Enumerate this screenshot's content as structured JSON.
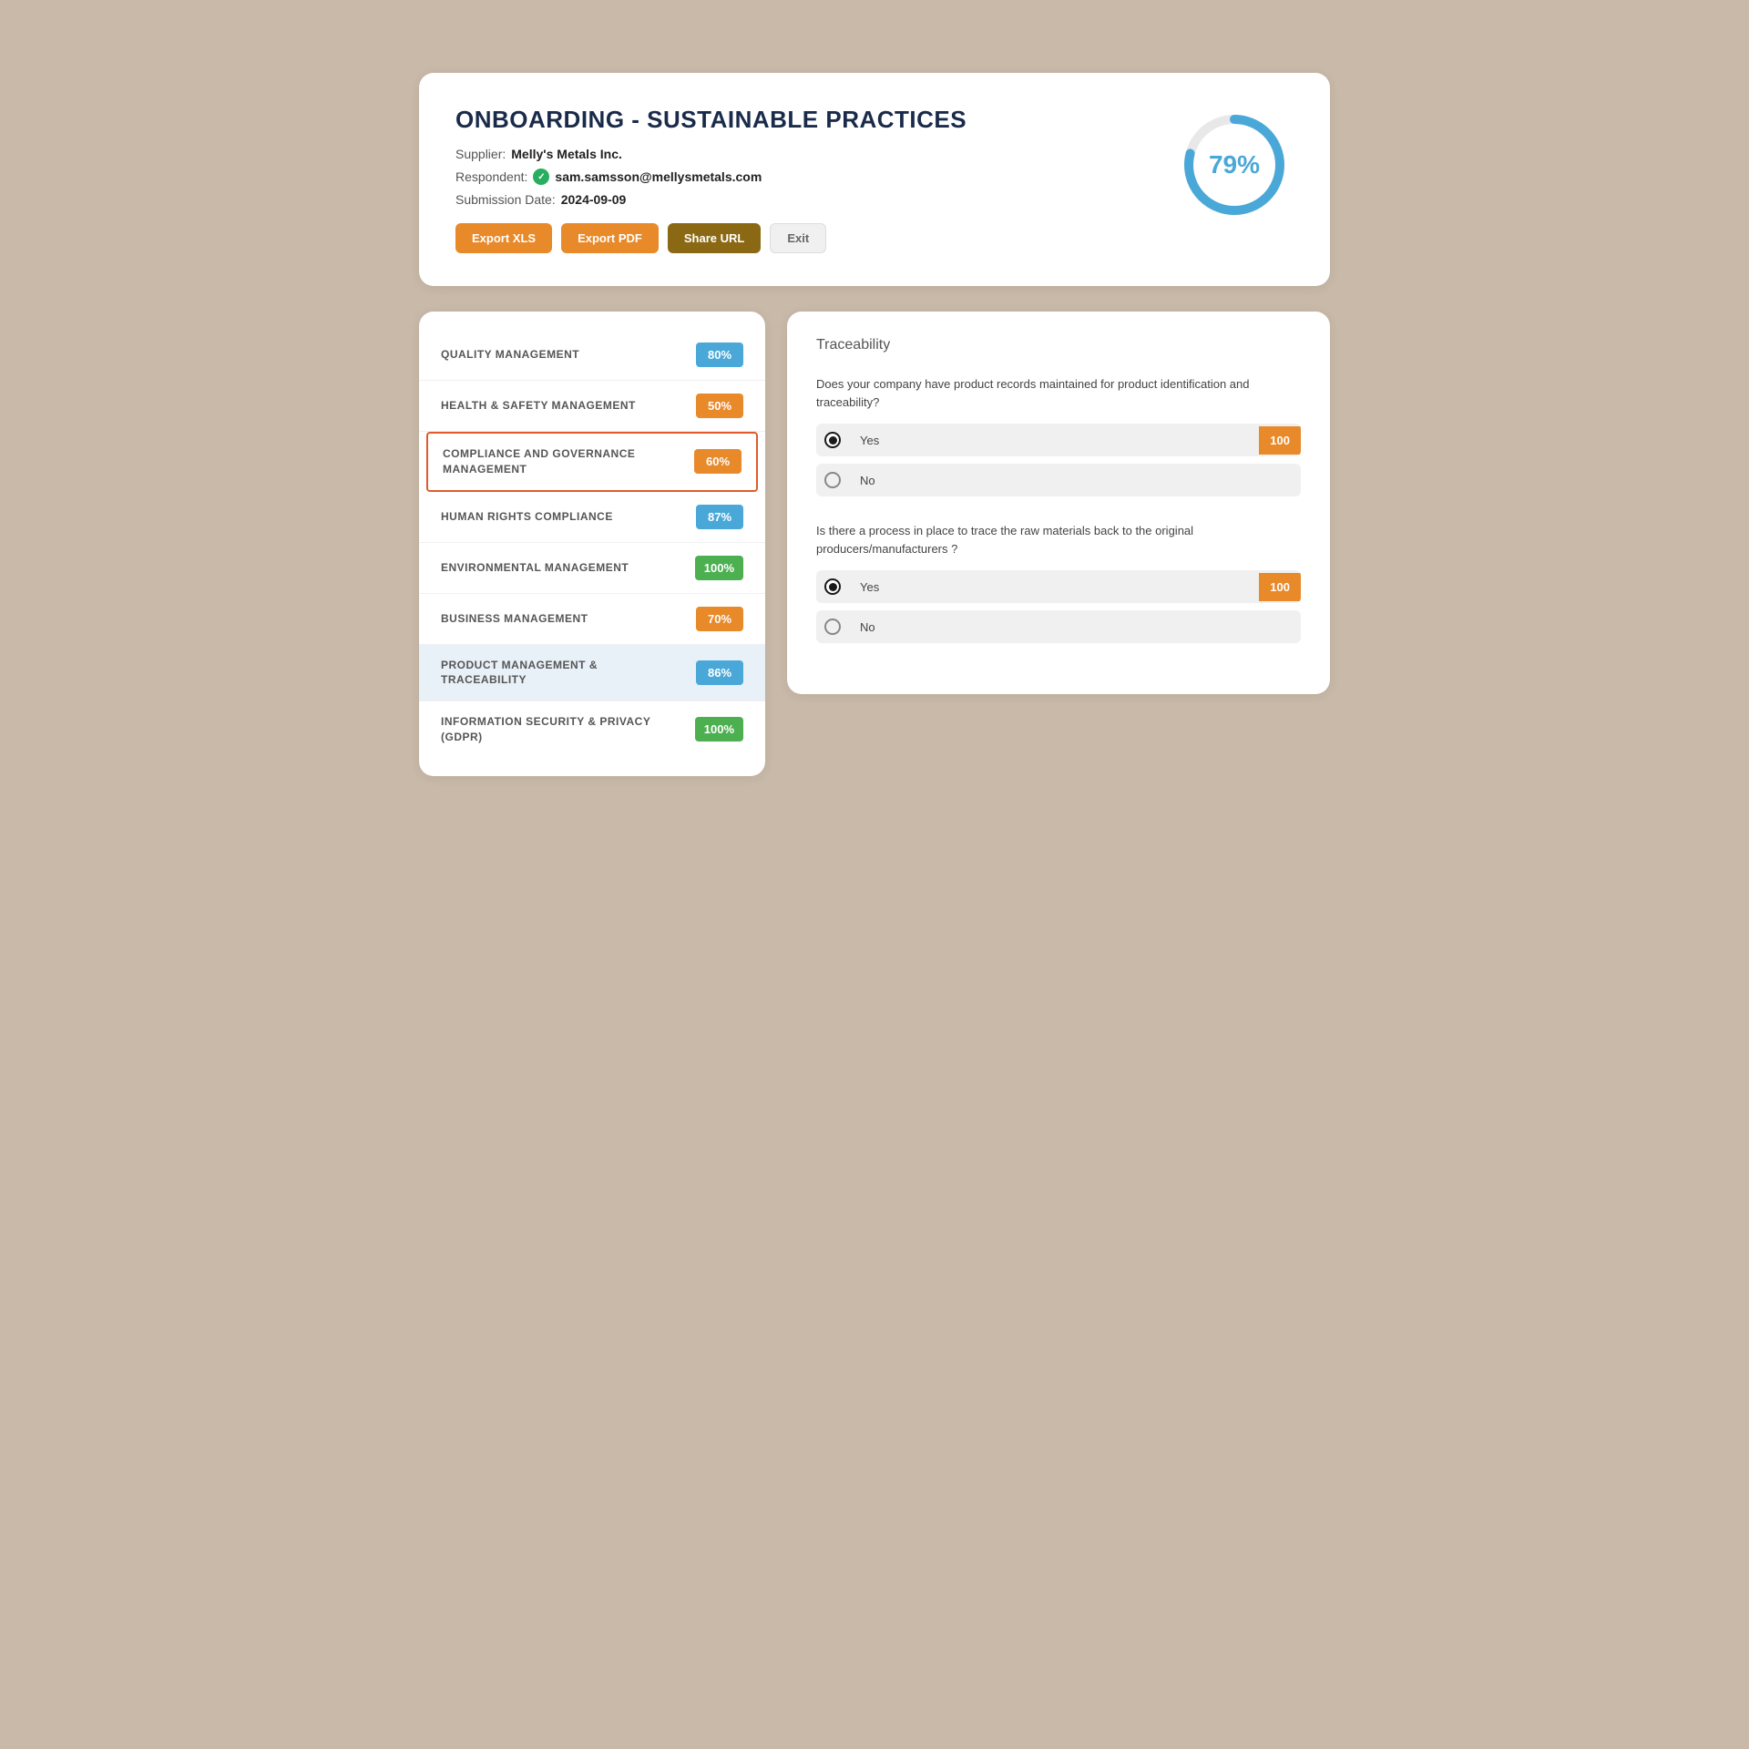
{
  "header": {
    "title": "ONBOARDING - SUSTAINABLE PRACTICES",
    "supplier_label": "Supplier:",
    "supplier_name": "Melly's Metals Inc.",
    "respondent_label": "Respondent:",
    "respondent_email": "sam.samsson@mellysmetals.com",
    "submission_label": "Submission Date:",
    "submission_date": "2024-09-09",
    "progress_percent": "79%",
    "progress_value": 79,
    "buttons": {
      "export_xls": "Export XLS",
      "export_pdf": "Export PDF",
      "share_url": "Share URL",
      "exit": "Exit"
    }
  },
  "categories": [
    {
      "name": "QUALITY MANAGEMENT",
      "score": "80%",
      "color": "blue",
      "selected": false,
      "highlighted": false
    },
    {
      "name": "HEALTH & SAFETY MANAGEMENT",
      "score": "50%",
      "color": "orange",
      "selected": false,
      "highlighted": false
    },
    {
      "name": "COMPLIANCE AND GOVERNANCE MANAGEMENT",
      "score": "60%",
      "color": "orange",
      "selected": true,
      "highlighted": false
    },
    {
      "name": "HUMAN RIGHTS COMPLIANCE",
      "score": "87%",
      "color": "blue",
      "selected": false,
      "highlighted": false
    },
    {
      "name": "ENVIRONMENTAL MANAGEMENT",
      "score": "100%",
      "color": "green",
      "selected": false,
      "highlighted": false
    },
    {
      "name": "BUSINESS MANAGEMENT",
      "score": "70%",
      "color": "orange",
      "selected": false,
      "highlighted": false
    },
    {
      "name": "PRODUCT MANAGEMENT & TRACEABILITY",
      "score": "86%",
      "color": "blue",
      "selected": false,
      "highlighted": true
    },
    {
      "name": "INFORMATION SECURITY & PRIVACY (GDPR)",
      "score": "100%",
      "color": "green",
      "selected": false,
      "highlighted": false
    }
  ],
  "detail": {
    "section_title": "Traceability",
    "questions": [
      {
        "id": "q1",
        "text": "Does your company have product records maintained for product identification and traceability?",
        "answers": [
          {
            "label": "Yes",
            "selected": true,
            "score": "100"
          },
          {
            "label": "No",
            "selected": false,
            "score": null
          }
        ]
      },
      {
        "id": "q2",
        "text": "Is there a process in place to trace the raw materials back to the original producers/manufacturers ?",
        "answers": [
          {
            "label": "Yes",
            "selected": true,
            "score": "100"
          },
          {
            "label": "No",
            "selected": false,
            "score": null
          }
        ]
      }
    ]
  }
}
